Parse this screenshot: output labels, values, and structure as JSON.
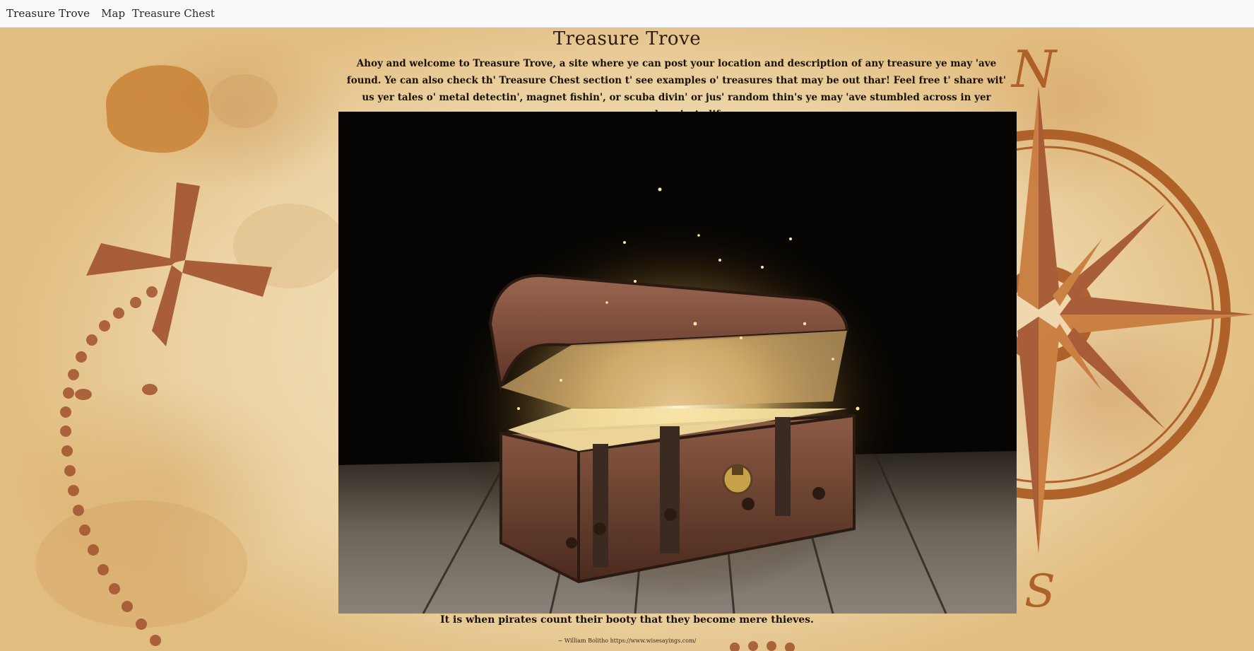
{
  "navbar": {
    "brand": "Treasure Trove",
    "links": [
      "Map",
      "Treasure Chest"
    ]
  },
  "main": {
    "title": "Treasure Trove",
    "intro": "Ahoy and welcome to Treasure Trove, a site where ye can post your location and description of any treasure ye may 'ave found. Ye can also check th' Treasure Chest section t' see examples o' treasures that may be out thar! Feel free t' share wit' us yer tales o' metal detectin', magnet fishin', or scuba divin' or jus' random thin's ye may 'ave stumbled across in yer everyday pirate life.",
    "quote": "It is when pirates count their booty that they become mere thieves.",
    "credit_author": "~ William Bolitho",
    "credit_url": "https://www.wisesayings.com/"
  },
  "colors": {
    "navbar_bg": "#f8f9fa",
    "parchment": "#ecd3a4",
    "ink": "#a1522e",
    "text": "#1a120c"
  },
  "icons": {
    "compass": "compass-rose-icon",
    "cross": "x-marks-spot-icon",
    "trail": "dotted-trail-icon",
    "chest": "treasure-chest-image"
  }
}
